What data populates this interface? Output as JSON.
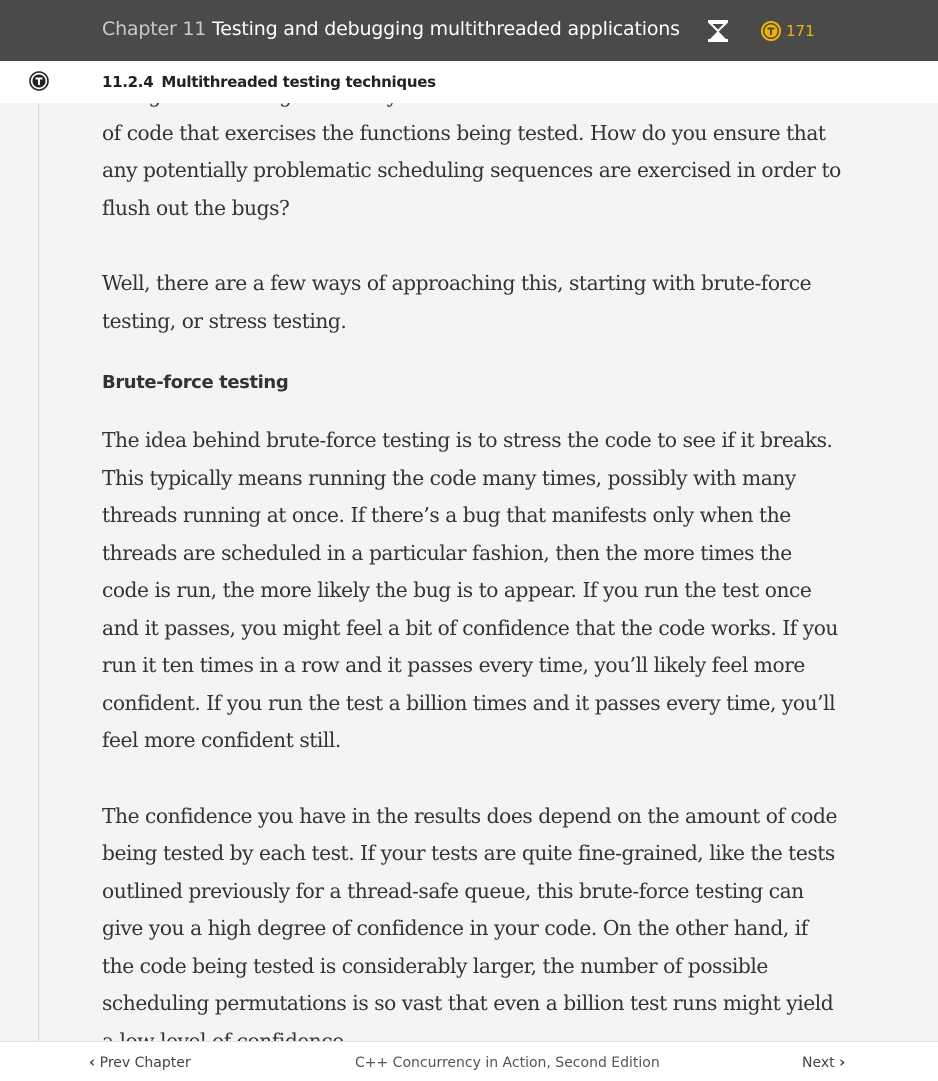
{
  "header": {
    "chapter_number": "Chapter 11",
    "chapter_title": "Testing and debugging multithreaded applications",
    "hourglass_icon": "hourglass-icon",
    "token_icon": "token-coin-icon",
    "token_count": "171",
    "colors": {
      "background": "#4a4a4a",
      "token": "#f0b400"
    }
  },
  "section": {
    "number": "11.2.4",
    "title": "Multithreaded testing techniques",
    "icon": "circle-t-icon"
  },
  "content": {
    "paragraphs": [
      "...ve got the testing scenario you want to test and written a small amount of code that exercises the functions being tested. How do you ensure that any potentially problematic scheduling sequences are exercised in order to flush out the bugs?",
      "Well, there are a few ways of approaching this, starting with brute-force testing, or stress testing."
    ],
    "heading": "Brute-force testing",
    "paragraphs_after": [
      "The idea behind brute-force testing is to stress the code to see if it breaks. This typically means running the code many times, possibly with many threads running at once. If there’s a bug that manifests only when the threads are scheduled in a particular fashion, then the more times the code is run, the more likely the bug is to appear. If you run the test once and it passes, you might feel a bit of confidence that the code works. If you run it ten times in a row and it passes every time, you’ll likely feel more confident. If you run the test a billion times and it passes every time, you’ll feel more confident still.",
      "The confidence you have in the results does depend on the amount of code being tested by each test. If your tests are quite fine-grained, like the tests outlined previously for a thread-safe queue, this brute-force testing can give you a high degree of confidence in your code. On the other hand, if the code being tested is considerably larger, the number of possible scheduling permutations is so vast that even a billion test runs might yield a low level of confidence."
    ]
  },
  "footer": {
    "prev_label": "Prev Chapter",
    "book_title": "C++ Concurrency in Action, Second Edition",
    "next_label": "Next"
  }
}
